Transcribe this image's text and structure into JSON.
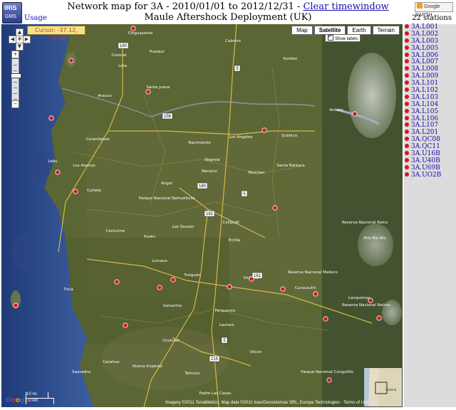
{
  "header": {
    "logo_line1": "IRIS",
    "logo_line2": "GMS",
    "usage_link": "Usage",
    "title_prefix": "Network map for 3A - 2010/01/01 to 2012/12/31 - ",
    "clear_link": "Clear timewindow",
    "subtitle": "Maule Aftershock Deployment (UK)",
    "google_earth_badge": "Google EARTH",
    "station_count": "22 stations"
  },
  "map": {
    "cursor_readout": "Cursor: -37.12, -72.20",
    "map_types": [
      {
        "label": "Map",
        "active": false
      },
      {
        "label": "Satellite",
        "active": true
      },
      {
        "label": "Earth",
        "active": false
      },
      {
        "label": "Terrain",
        "active": false
      }
    ],
    "show_labels": "Show labels",
    "scale_mi": "10 mi",
    "scale_km": "20 km",
    "google_logo": "Google",
    "attribution": "Imagery ©2011 TerraMetrics, Map data ©2011 Inav/Geosistemas SRL, Europa Technologies - Terms of Use",
    "overview_label": "Victoria",
    "place_labels": [
      "Chiguayante",
      "Hualqui",
      "Cabrero",
      "Yumbel",
      "Santa Juana",
      "Coronel",
      "Lota",
      "Arauco",
      "Los Angeles",
      "Quilleco",
      "Nacimiento",
      "Negrete",
      "Renaico",
      "Mulchen",
      "Santa Barbara",
      "Antuco",
      "Curanilahue",
      "Lebu",
      "Los Alamos",
      "Cañete",
      "Angol",
      "Parque Nacional Nahuelbuta",
      "Collipulli",
      "Los Sauces",
      "Contulmo",
      "Purén",
      "Ercilla",
      "Lumaco",
      "Traiguén",
      "Victoria",
      "Curacautín",
      "Lonquimay",
      "Tirúa",
      "Galvarino",
      "Perquenco",
      "Lautaro",
      "Cholchol",
      "Vilcún",
      "Temuco",
      "Padre Las Casas",
      "Nueva Imperial",
      "Carahue",
      "Saavedra",
      "Reserva Nacional Malleco",
      "Reserva Nacional Nalcas",
      "Parque Nacional Conguillio",
      "Reserva Nacional Ralco",
      "Alto Bío Bío"
    ],
    "road_labels": [
      "160",
      "5",
      "156",
      "180",
      "182",
      "215",
      "5",
      "181",
      "5"
    ],
    "colors": {
      "marker": "#d6171c",
      "ocean": "#2f4d8a",
      "land": "#556232",
      "road": "#e3c24a"
    }
  },
  "stations": [
    "3A.L001",
    "3A.L002",
    "3A.L003",
    "3A.L005",
    "3A.L006",
    "3A.L007",
    "3A.L008",
    "3A.L009",
    "3A.L101",
    "3A.L102",
    "3A.L103",
    "3A.L104",
    "3A.L105",
    "3A.L106",
    "3A.L107",
    "3A.L201",
    "3A.QC08",
    "3A.QC11",
    "3A.U16B",
    "3A.U40B",
    "3A.U69B",
    "3A.UO2B"
  ]
}
